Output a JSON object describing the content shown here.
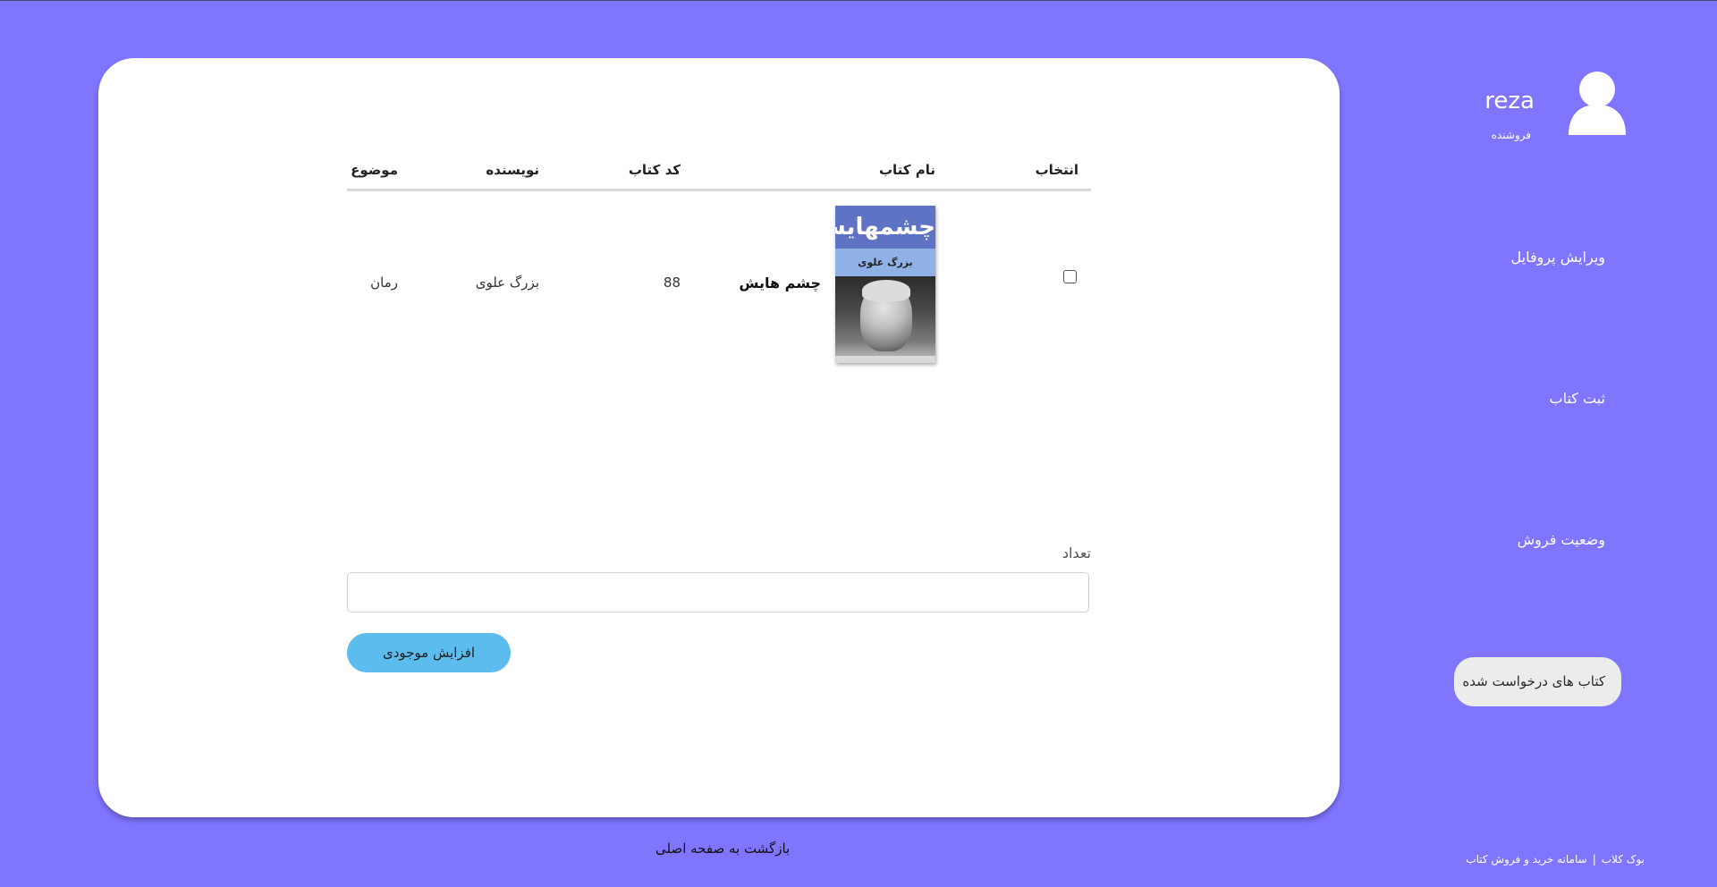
{
  "user": {
    "name": "reza",
    "role": "فروشنده"
  },
  "sidebar": {
    "items": [
      {
        "label": "ویرایش پروفایل"
      },
      {
        "label": "ثبت کتاب"
      },
      {
        "label": "وضعیت فروش"
      },
      {
        "label": "کتاب های درخواست شده"
      }
    ],
    "active_item": "کتاب های درخواست شده"
  },
  "table": {
    "headers": {
      "select": "انتخاب",
      "book_name": "نام کتاب",
      "book_code": "کد کتاب",
      "author": "نویسنده",
      "subject": "موضوع"
    },
    "rows": [
      {
        "selected": false,
        "book_name": "چشم هایش",
        "book_code": "88",
        "author": "بزرگ علوی",
        "subject": "رمان",
        "cover": {
          "title": "چشمهایش",
          "author": "بزرگ علوی"
        }
      }
    ]
  },
  "form": {
    "quantity_label": "تعداد",
    "quantity_value": "",
    "submit_label": "افزایش موجودی"
  },
  "footer": {
    "back_link": "بازگشت به صفحه اصلی",
    "brand_name": "بوک کلاب",
    "brand_tagline": "سامانه خرید و فروش کتاب",
    "separator": "|"
  },
  "colors": {
    "background": "#8075ff",
    "card": "#ffffff",
    "button": "#5cbcee",
    "active_nav": "#ececec"
  }
}
